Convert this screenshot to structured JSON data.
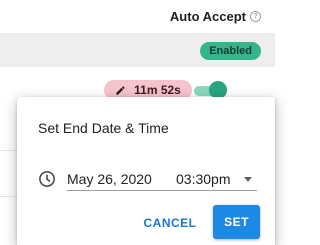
{
  "header": {
    "auto_accept_label": "Auto Accept",
    "help_icon": "question-circle-icon"
  },
  "table": {
    "status_badge": "Enabled",
    "timer_label": "11m 52s",
    "toggle_on": true
  },
  "dialog": {
    "title": "Set End Date & Time",
    "date": "May 26, 2020",
    "time": "03:30pm",
    "cancel_label": "CANCEL",
    "set_label": "SET"
  },
  "colors": {
    "badge_green": "#35b58c",
    "chip_pink": "#f7c3cc",
    "toggle_green": "#2aa584",
    "primary_blue": "#1e88e5"
  }
}
